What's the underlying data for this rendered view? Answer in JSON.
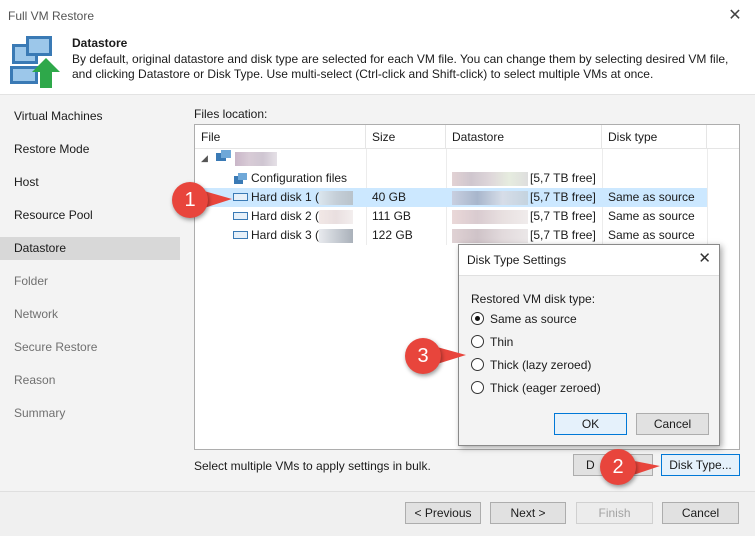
{
  "window": {
    "title": "Full VM Restore"
  },
  "header": {
    "title": "Datastore",
    "description": "By default, original datastore and disk type are selected for each VM file. You can change them by selecting desired VM file, and clicking Datastore or Disk Type. Use multi-select (Ctrl-click and Shift-click) to select multiple VMs at once."
  },
  "sidebar": {
    "items": [
      {
        "label": "Virtual Machines",
        "state": "done"
      },
      {
        "label": "Restore Mode",
        "state": "done"
      },
      {
        "label": "Host",
        "state": "done"
      },
      {
        "label": "Resource Pool",
        "state": "done"
      },
      {
        "label": "Datastore",
        "state": "active"
      },
      {
        "label": "Folder",
        "state": "pending"
      },
      {
        "label": "Network",
        "state": "pending"
      },
      {
        "label": "Secure Restore",
        "state": "pending"
      },
      {
        "label": "Reason",
        "state": "pending"
      },
      {
        "label": "Summary",
        "state": "pending"
      }
    ]
  },
  "files": {
    "label": "Files location:",
    "columns": [
      "File",
      "Size",
      "Datastore",
      "Disk type"
    ],
    "rows": [
      {
        "file": "Configuration files",
        "size": "",
        "datastore": "[5,7 TB free]",
        "disk_type": ""
      },
      {
        "file": "Hard disk 1 (",
        "size": "40 GB",
        "datastore": "[5,7 TB free]",
        "disk_type": "Same as source"
      },
      {
        "file": "Hard disk 2 (",
        "size": "111 GB",
        "datastore": "[5,7 TB free]",
        "disk_type": "Same as source"
      },
      {
        "file": "Hard disk 3 (",
        "size": "122 GB",
        "datastore": "[5,7 TB free]",
        "disk_type": "Same as source"
      }
    ],
    "bulk_note": "Select multiple VMs to apply settings in bulk.",
    "datastore_button": "D",
    "disk_type_button": "Disk Type..."
  },
  "dialog": {
    "title": "Disk Type Settings",
    "label": "Restored VM disk type:",
    "options": [
      {
        "label": "Same as source",
        "selected": true
      },
      {
        "label": "Thin",
        "selected": false
      },
      {
        "label": "Thick (lazy zeroed)",
        "selected": false
      },
      {
        "label": "Thick (eager zeroed)",
        "selected": false
      }
    ],
    "ok": "OK",
    "cancel": "Cancel"
  },
  "footer": {
    "previous": "< Previous",
    "next": "Next >",
    "finish": "Finish",
    "cancel": "Cancel"
  },
  "callouts": [
    "1",
    "2",
    "3"
  ],
  "colors": {
    "accent": "#0078d7",
    "selection": "#cce8ff",
    "callout": "#e8453c",
    "sidebar_active": "#d8d8d8"
  }
}
